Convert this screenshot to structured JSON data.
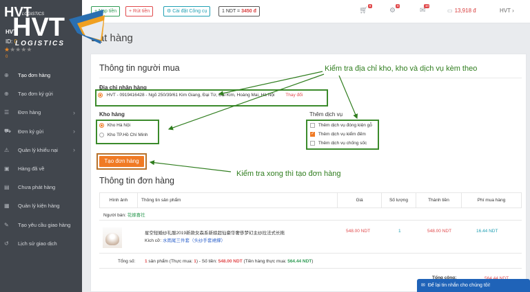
{
  "logo": {
    "text": "HVT",
    "sub": "LOGISTICS"
  },
  "sidebar": {
    "user": "HVT",
    "id_label": "ID:",
    "id_value": "0",
    "stars": [
      "★",
      "★",
      "★",
      "★",
      "★"
    ],
    "zero": "0",
    "items": [
      {
        "label": "Tạo đơn hàng",
        "icon": "plus-icon",
        "chev": ""
      },
      {
        "label": "Tạo đơn ký gửi",
        "icon": "plus-icon",
        "chev": ""
      },
      {
        "label": "Đơn hàng",
        "icon": "list-icon",
        "chev": "›"
      },
      {
        "label": "Đơn ký gửi",
        "icon": "cart-icon",
        "chev": "›"
      },
      {
        "label": "Quản lý khiếu nại",
        "icon": "warning-icon",
        "chev": "›"
      },
      {
        "label": "Hàng đã về",
        "icon": "box-icon",
        "chev": ""
      },
      {
        "label": "Chưa phát hàng",
        "icon": "truck-icon",
        "chev": ""
      },
      {
        "label": "Quản lý kiện hàng",
        "icon": "package-icon",
        "chev": ""
      },
      {
        "label": "Tạo yêu cầu giao hàng",
        "icon": "request-icon",
        "chev": ""
      },
      {
        "label": "Lịch sử giao dịch",
        "icon": "history-icon",
        "chev": ""
      }
    ]
  },
  "topbar": {
    "deposit": "+ Nạp tiền",
    "withdraw": "+ Rút tiền",
    "install": "⚙ Cài đặt Công cụ",
    "rate_prefix": "1 NDT =",
    "rate_value": "3450 đ",
    "cart_badge": "8",
    "notify_badge": "0",
    "mail_badge": "10",
    "wallet": "13,918 đ",
    "user": "HVT ›"
  },
  "page": {
    "title": "Đặt hàng",
    "buyer_title": "Thông tin người mua",
    "address_label": "Địa chỉ nhận hàng",
    "address": "HVT - 0919416428 - Ngõ 250/39/61 Kim Giang, Đại Từ, Đại Kim, Hoàng Mai, Hà Nội",
    "change": "Thay đổi",
    "warehouse_label": "Kho hàng",
    "warehouses": [
      "Kho Hà Nội",
      "Kho TP.Hồ Chí Minh"
    ],
    "services_label": "Thêm dịch vụ",
    "services": [
      "Thêm dịch vụ đóng kiện gỗ",
      "Thêm dịch vụ kiểm đếm",
      "Thêm dịch vụ chống sốc"
    ],
    "submit": "Tạo đơn hàng",
    "order_title": "Thông tin đơn hàng"
  },
  "callouts": {
    "top": "Kiểm tra địa chỉ kho, kho và dịch vụ kèm theo",
    "bottom": "Kiểm tra xong thì tạo đơn hàng"
  },
  "table": {
    "headers": [
      "Hình ảnh",
      "Thông tin sản phẩm",
      "Giá",
      "Số lượng",
      "Thành tiền",
      "Phí mua hàng"
    ],
    "seller_label": "Người bán:",
    "seller": "花嫁喜社",
    "product_name": "星空轻婚纱礼服2019新款女森系新娘超仙豪华奢侈梦幻主纱拉法式长拖",
    "size_label": "Kích cỡ:",
    "size_value": "水雨尾三件套（头纱手套裙撑）",
    "price": "548.00 NDT",
    "qty": "1",
    "subtotal": "548.00 NDT",
    "fee": "16.44 NDT",
    "total_label": "Tổng số:",
    "total_n": "1",
    "total_mid1": " sản phẩm (Thực mua: ",
    "total_actual": "1",
    "total_mid2": ") - Số tiền: ",
    "total_money": "548.00 NDT",
    "total_mid3": " (Tiền hàng thực mua: ",
    "total_real": "564.44 NDT",
    "total_end": ")",
    "paid_label": "Tổng cộng:",
    "paid_value": "564.44 NDT"
  },
  "chat": {
    "text": "Để lại tin nhắn cho chúng tôi!"
  },
  "colors": {
    "accent": "#f07a24",
    "green": "#2f7d1e",
    "sidebar": "#41464d"
  }
}
